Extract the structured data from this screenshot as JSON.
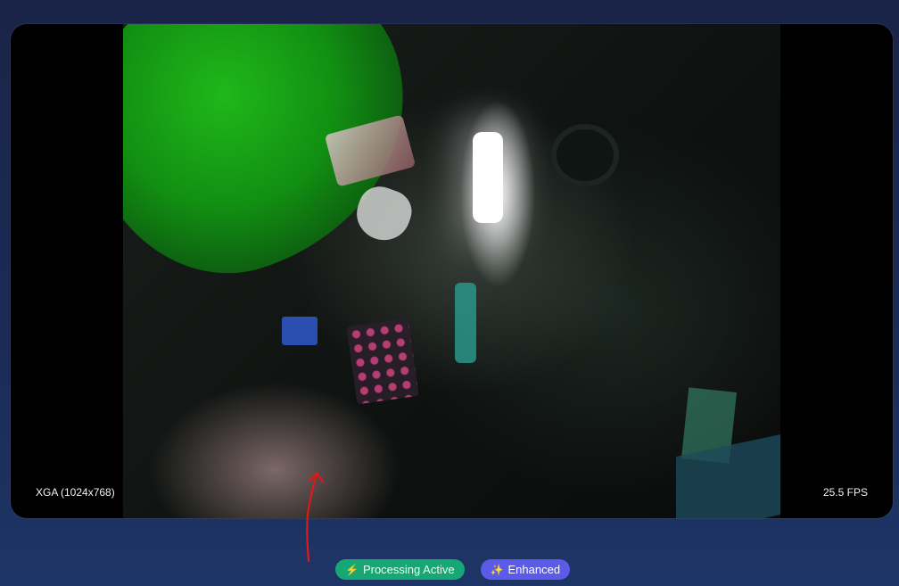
{
  "viewer": {
    "resolution_label": "XGA (1024x768)",
    "fps_label": "25.5 FPS"
  },
  "badges": [
    {
      "label": "Processing Active",
      "icon": "lightning-icon",
      "color": "#16a774"
    },
    {
      "label": "Enhanced",
      "icon": "sparkles-icon",
      "color": "#5b5be8"
    }
  ],
  "annotation": {
    "color": "#e01818",
    "icon": "red-arrow-annotation"
  }
}
